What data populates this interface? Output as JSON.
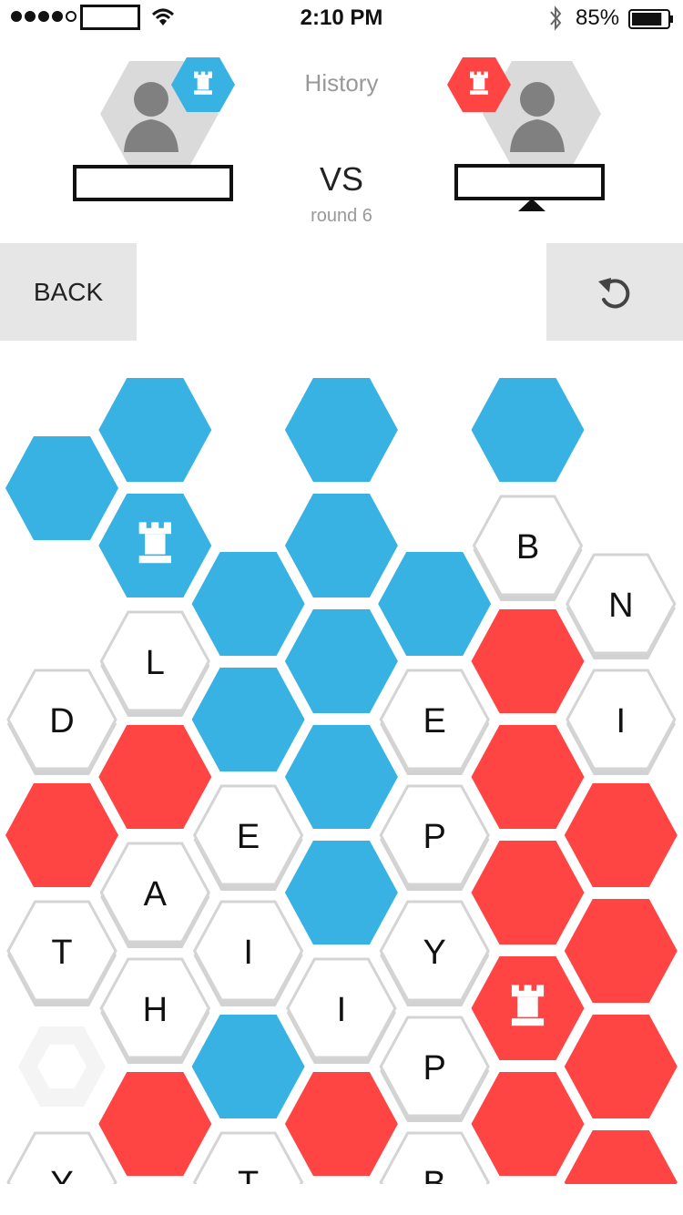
{
  "status_bar": {
    "time": "2:10 PM",
    "battery_percent": "85%",
    "signal_dots_filled": 4,
    "signal_dots_total": 5,
    "battery_level": 0.85
  },
  "header": {
    "history_label": "History",
    "vs_label": "VS",
    "round_label": "round 6"
  },
  "players": {
    "left": {
      "color": "#37B2E3",
      "icon": "rook-icon",
      "name": ""
    },
    "right": {
      "color": "#FF4444",
      "icon": "rook-icon",
      "name": "",
      "is_current_turn": true
    }
  },
  "controls": {
    "back_label": "BACK",
    "undo_icon": "undo-icon"
  },
  "colors": {
    "blue": "#37B2E3",
    "red": "#FF4444",
    "tile_border": "#d4d4d4",
    "tile_fill": "#ffffff"
  },
  "board": {
    "columns": 7,
    "tiles": [
      [
        {
          "state": "blue"
        },
        {
          "state": "empty"
        },
        {
          "letter": "D"
        },
        {
          "state": "red"
        },
        {
          "letter": "T"
        },
        {
          "state": "ghost"
        },
        {
          "letter": "Y"
        }
      ],
      [
        {
          "state": "blue"
        },
        {
          "state": "blue",
          "icon": "rook-icon"
        },
        {
          "letter": "L"
        },
        {
          "state": "red"
        },
        {
          "letter": "A"
        },
        {
          "letter": "H"
        },
        {
          "state": "red"
        }
      ],
      [
        {
          "state": "empty"
        },
        {
          "state": "blue"
        },
        {
          "state": "blue"
        },
        {
          "letter": "E"
        },
        {
          "letter": "I"
        },
        {
          "state": "blue"
        },
        {
          "letter": "T"
        }
      ],
      [
        {
          "state": "blue"
        },
        {
          "state": "blue"
        },
        {
          "state": "blue"
        },
        {
          "state": "blue"
        },
        {
          "state": "blue"
        },
        {
          "letter": "I"
        },
        {
          "state": "red"
        }
      ],
      [
        {
          "state": "empty"
        },
        {
          "state": "blue"
        },
        {
          "letter": "E"
        },
        {
          "letter": "P"
        },
        {
          "letter": "Y"
        },
        {
          "letter": "P"
        },
        {
          "letter": "B"
        }
      ],
      [
        {
          "state": "blue"
        },
        {
          "letter": "B"
        },
        {
          "state": "red"
        },
        {
          "state": "red"
        },
        {
          "state": "red"
        },
        {
          "state": "red",
          "icon": "rook-icon"
        },
        {
          "state": "red"
        }
      ],
      [
        {
          "state": "empty"
        },
        {
          "letter": "N"
        },
        {
          "letter": "I"
        },
        {
          "state": "red"
        },
        {
          "state": "red"
        },
        {
          "state": "red"
        },
        {
          "state": "red"
        }
      ]
    ]
  }
}
